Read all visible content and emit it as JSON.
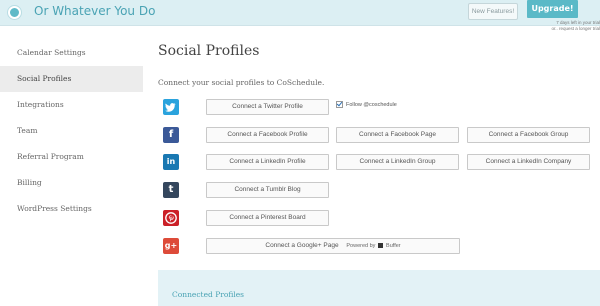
{
  "header": {
    "brand": "Or Whatever You Do",
    "new_features_label": "New Features!",
    "upgrade_label": "Upgrade!",
    "trial_line1": "7 days left in your trial",
    "trial_line2": "or.. request a longer trial"
  },
  "sidebar": {
    "items": [
      {
        "label": "Calendar Settings"
      },
      {
        "label": "Social Profiles"
      },
      {
        "label": "Integrations"
      },
      {
        "label": "Team"
      },
      {
        "label": "Referral Program"
      },
      {
        "label": "Billing"
      },
      {
        "label": "WordPress Settings"
      }
    ],
    "active": "Social Profiles"
  },
  "main": {
    "title": "Social Profiles",
    "subtitle": "Connect your social profiles to CoSchedule.",
    "twitter": {
      "connect_label": "Connect a Twitter Profile",
      "follow_label": "Follow @coschedule",
      "follow_checked": true
    },
    "facebook": {
      "profile_label": "Connect a Facebook Profile",
      "page_label": "Connect a Facebook Page",
      "group_label": "Connect a Facebook Group"
    },
    "linkedin": {
      "profile_label": "Connect a LinkedIn Profile",
      "group_label": "Connect a LinkedIn Group",
      "company_label": "Connect a LinkedIn Company"
    },
    "tumblr": {
      "blog_label": "Connect a Tumblr Blog"
    },
    "pinterest": {
      "board_label": "Connect a Pinterest Board"
    },
    "gplus": {
      "page_label": "Connect a Google+ Page",
      "powered_prefix": "Powered by",
      "powered_brand": "Buffer"
    },
    "connected_title": "Connected Profiles"
  },
  "icons": {
    "twitter": {
      "glyph": "🐦",
      "color": "#2aa3dd"
    },
    "facebook": {
      "glyph": "f",
      "color": "#3b5998"
    },
    "linkedin": {
      "glyph": "in",
      "color": "#1978b2"
    },
    "tumblr": {
      "glyph": "t",
      "color": "#34465d"
    },
    "pinterest": {
      "glyph": "P",
      "color": "#cb2027"
    },
    "gplus": {
      "glyph": "g+",
      "color": "#dd4b39"
    }
  },
  "colors": {
    "accent": "#5ab9c7",
    "header_bg": "#dceff3",
    "panel_bg": "#e3f2f6"
  }
}
